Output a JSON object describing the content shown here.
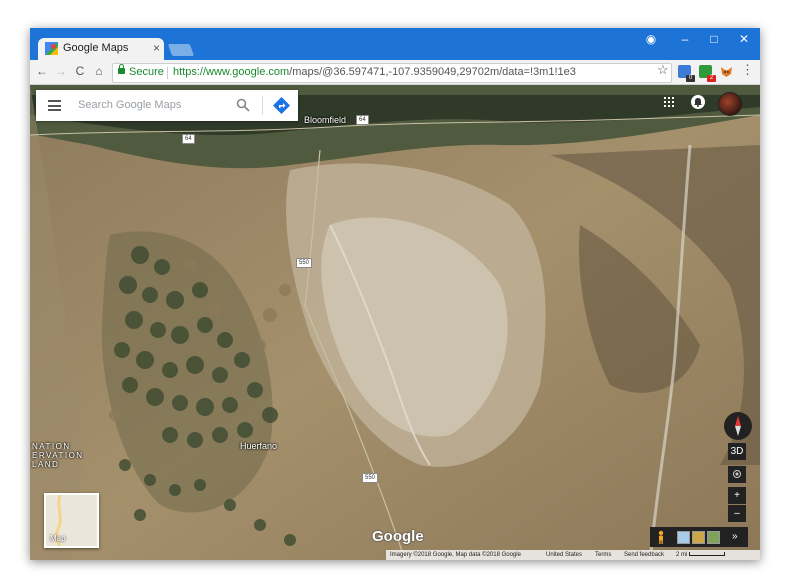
{
  "browser": {
    "tab_title": "Google Maps",
    "tab_close": "×",
    "window_controls": {
      "profile": "◉",
      "minimize": "–",
      "maximize": "□",
      "close": "✕"
    },
    "nav": {
      "back": "←",
      "forward": "→",
      "reload": "C",
      "home": "⌂"
    },
    "secure_label": "Secure",
    "url_host": "https://www.google.com",
    "url_path": "/maps/@36.597471,-107.9359049,29702m/data=!3m1!1e3",
    "star": "☆",
    "extension_badges": [
      "0",
      "2"
    ],
    "menu": "⋮",
    "accent_color": "#1e73d6"
  },
  "maps": {
    "search_placeholder": "Search Google Maps",
    "labels": {
      "bloomfield": "Bloomfield",
      "huerfano": "Huerfano",
      "reservation_lines": [
        "NATION",
        "ERVATION",
        "LAND"
      ]
    },
    "road_shields": {
      "hwy64_a": "64",
      "hwy64_b": "64",
      "hwy550_a": "550",
      "hwy550_b": "550"
    },
    "minimap_label": "Map",
    "logo": "Google",
    "controls": {
      "three_d": "3D",
      "zoom_in": "+",
      "zoom_out": "–",
      "expand": "»"
    },
    "footer": {
      "imagery": "Imagery ©2018 Google, Map data ©2018 Google",
      "country": "United States",
      "terms": "Terms",
      "feedback": "Send feedback",
      "scale": "2 mi"
    }
  }
}
